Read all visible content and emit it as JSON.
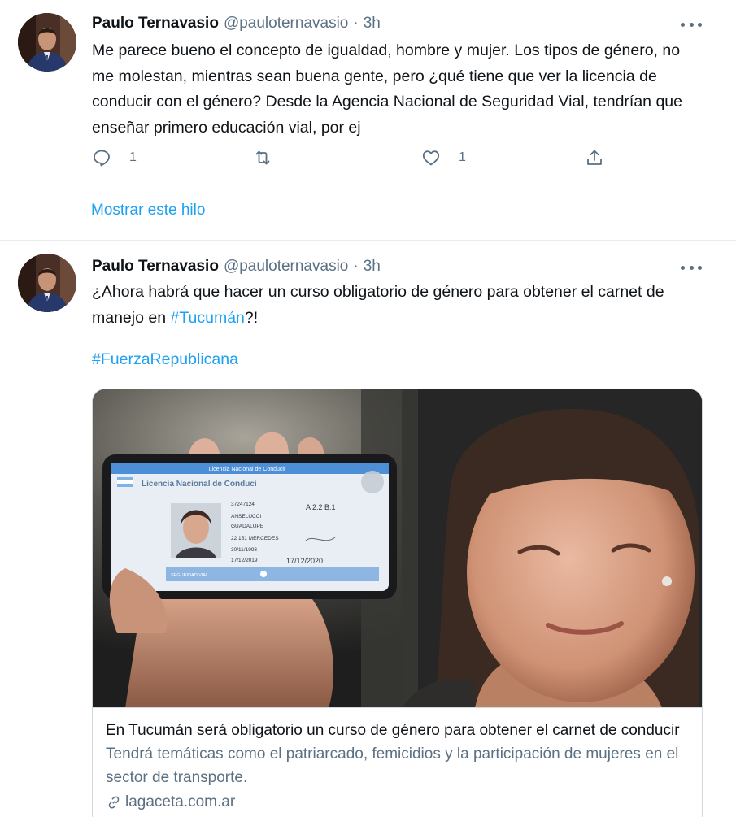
{
  "tweets": [
    {
      "author_name": "Paulo Ternavasio",
      "handle": "@pauloternavasio",
      "separator": "·",
      "time": "3h",
      "text": "Me parece bueno el concepto de igualdad, hombre y mujer. Los tipos de género, no me molestan, mientras sean buena gente, pero ¿qué tiene que ver la licencia de conducir con el género? Desde la Agencia Nacional de Seguridad Vial, tendrían que enseñar primero educación vial, por ej",
      "reply_count": "1",
      "retweet_count": "",
      "like_count": "1",
      "show_thread": "Mostrar este hilo"
    },
    {
      "author_name": "Paulo Ternavasio",
      "handle": "@pauloternavasio",
      "separator": "·",
      "time": "3h",
      "text_before": "¿Ahora habrá que hacer un curso obligatorio de género para obtener el carnet de manejo en ",
      "hashtag_inline": "#Tucumán",
      "text_after": "?!",
      "hashtag2": "#FuerzaRepublicana",
      "card": {
        "image_text": {
          "license_header": "Licencia Nacional de Conducir",
          "license_title": "Licencia Nacional de Conduci",
          "field_number": "37247124",
          "field_surname": "ANSELUCCI",
          "field_name": "GUADALUPE",
          "field_address": "22 151 MERCEDES",
          "field_dob": "30/11/1993",
          "field_issue": "17/12/2019",
          "field_class": "A 2.2 B.1",
          "field_expiry": "17/12/2020",
          "footer_left": "SEGURIDAD VIAL"
        },
        "title": "En Tucumán será obligatorio un curso de género para obtener el carnet de conducir",
        "description": "Tendrá temáticas como el patriarcado, femicidios y la participación de mujeres en el sector de transporte.",
        "domain": "lagaceta.com.ar"
      }
    }
  ],
  "colors": {
    "accent": "#1da1f2",
    "text": "#0f1419",
    "secondary": "#5b7083",
    "border": "#e6ecf0"
  },
  "icons": {
    "more": "more-horizontal-icon",
    "reply": "reply-icon",
    "retweet": "retweet-icon",
    "like": "heart-icon",
    "share": "share-icon",
    "link": "link-icon"
  }
}
